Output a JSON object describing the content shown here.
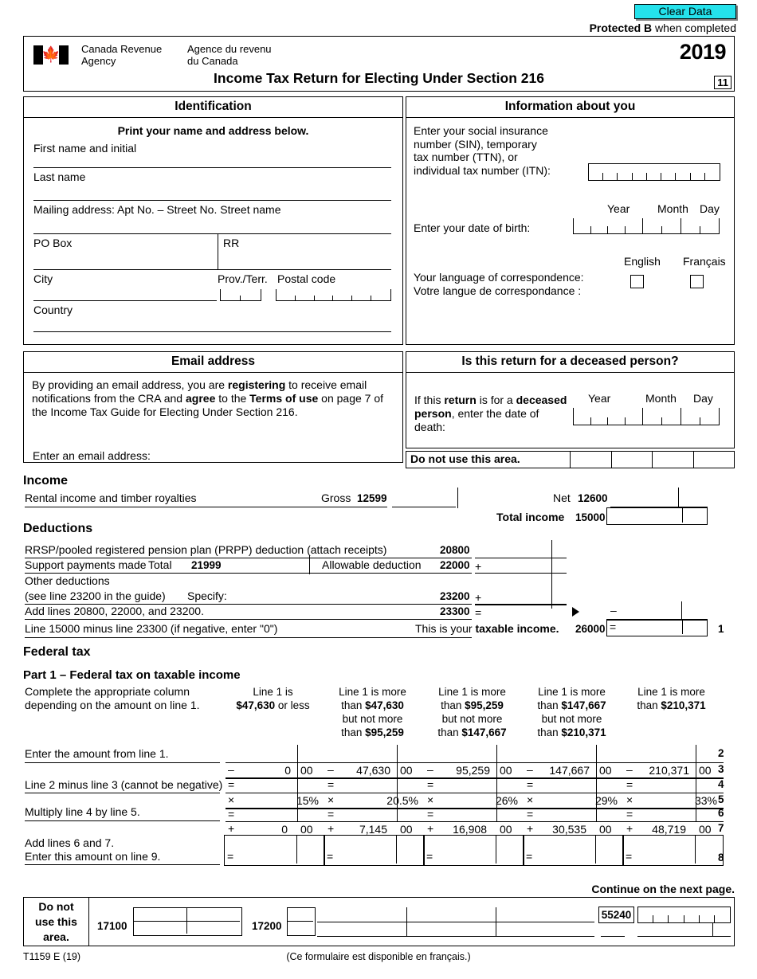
{
  "toolbar": {
    "clear_data_label": "Clear Data",
    "clear_data_color": "#24e2ec",
    "protected_bold": "Protected B",
    "protected_rest": " when completed"
  },
  "header": {
    "agency_en_line1": "Canada Revenue",
    "agency_en_line2": "Agency",
    "agency_fr_line1": "Agence du revenu",
    "agency_fr_line2": "du Canada",
    "tax_year": "2019",
    "title": "Income Tax Return for Electing Under Section 216",
    "page_number": "11"
  },
  "identification": {
    "heading": "Identification",
    "subtitle": "Print your name and address below.",
    "first_name_label": "First name and initial",
    "last_name_label": "Last name",
    "mailing_label": "Mailing address: Apt No. – Street No. Street name",
    "po_box_label": "PO Box",
    "rr_label": "RR",
    "city_label": "City",
    "prov_label": "Prov./Terr.",
    "postal_label": "Postal code",
    "country_label": "Country",
    "prov_cells": 2,
    "postal_cells": 6
  },
  "info_about_you": {
    "heading": "Information about you",
    "sin_line1": "Enter your social insurance",
    "sin_line2": "number (SIN), temporary",
    "sin_line3": "tax number (TTN), or",
    "sin_line4": "individual tax number (ITN):",
    "sin_cells": 9,
    "dob_label": "Enter your date of birth:",
    "year_label": "Year",
    "month_label": "Month",
    "day_label": "Day",
    "dob_year_cells": 4,
    "dob_month_cells": 2,
    "dob_day_cells": 2,
    "lang_en_label": "Your language of correspondence:",
    "lang_fr_label": "Votre langue de correspondance :",
    "lang_option_english": "English",
    "lang_option_francais": "Français"
  },
  "email": {
    "heading": "Email address",
    "body_1": "By providing an email address, you are ",
    "body_bold_1": "registering",
    "body_2": " to receive email notifications from the CRA and ",
    "body_bold_2": "agree",
    "body_3": " to the ",
    "body_bold_3": "Terms of use",
    "body_4": " on page 7 of the Income Tax Guide for Electing Under Section 216.",
    "enter_label": "Enter an email address:"
  },
  "deceased": {
    "heading": "Is this return for a deceased person?",
    "text_1": "If this ",
    "text_bold_1": "return",
    "text_2": " is for a ",
    "text_bold_2": "deceased person",
    "text_3": ", enter the date of death:",
    "year_label": "Year",
    "month_label": "Month",
    "day_label": "Day",
    "year_cells": 4,
    "month_cells": 2,
    "day_cells": 2,
    "do_not_use_label": "Do not use this area.",
    "do_not_use_cells": 4
  },
  "income": {
    "heading": "Income",
    "row_label": "Rental income and timber royalties",
    "gross_label": "Gross",
    "gross_code": "12599",
    "net_label": "Net",
    "net_code": "12600",
    "total_label": "Total income",
    "total_code": "15000"
  },
  "deductions": {
    "heading": "Deductions",
    "rrsp_label": "RRSP/pooled registered pension plan (PRPP) deduction (attach receipts)",
    "rrsp_code": "20800",
    "support_label": "Support payments made",
    "support_total_label": "Total",
    "support_total_code": "21999",
    "allowable_label": "Allowable deduction",
    "allowable_code": "22000",
    "allowable_op": "+",
    "other_label_1": "Other deductions",
    "other_label_2": "(see line 23200 in the guide)",
    "specify_label": "Specify:",
    "other_code": "23200",
    "other_op": "+",
    "add_label": "Add lines 20800, 22000, and 23200.",
    "add_code": "23300",
    "add_op": "=",
    "carry_op": "–",
    "taxable_label": "Line 15000 minus line 23300 (if negative, enter \"0\")",
    "taxable_this_is": "This is your ",
    "taxable_bold": "taxable income.",
    "taxable_code": "26000",
    "taxable_op": "=",
    "taxable_lineno": "1"
  },
  "federal_tax": {
    "heading": "Federal tax",
    "part1_heading": "Part 1 – Federal tax on taxable income",
    "instruction_line1": "Complete the appropriate column",
    "instruction_line2": "depending on the amount on line 1.",
    "columns": [
      {
        "head_lines": [
          "Line 1 is",
          "$47,630 or less"
        ],
        "head_bold": [
          "",
          "$47,630"
        ],
        "subtract": "0",
        "cents": "00",
        "rate": "15%",
        "add_amount": "0",
        "add_cents": "00"
      },
      {
        "head_lines": [
          "Line 1 is more",
          "than $47,630",
          "but not more",
          "than $95,259"
        ],
        "head_bold": [
          "",
          "$47,630",
          "",
          "$95,259"
        ],
        "subtract": "47,630",
        "cents": "00",
        "rate": "20.5%",
        "add_amount": "7,145",
        "add_cents": "00"
      },
      {
        "head_lines": [
          "Line 1 is more",
          "than $95,259",
          "but not more",
          "than $147,667"
        ],
        "head_bold": [
          "",
          "$95,259",
          "",
          "$147,667"
        ],
        "subtract": "95,259",
        "cents": "00",
        "rate": "26%",
        "add_amount": "16,908",
        "add_cents": "00"
      },
      {
        "head_lines": [
          "Line 1 is more",
          "than $147,667",
          "but not more",
          "than $210,371"
        ],
        "head_bold": [
          "",
          "$147,667",
          "",
          "$210,371"
        ],
        "subtract": "147,667",
        "cents": "00",
        "rate": "29%",
        "add_amount": "30,535",
        "add_cents": "00"
      },
      {
        "head_lines": [
          "Line 1 is more",
          "than $210,371"
        ],
        "head_bold": [
          "",
          "$210,371"
        ],
        "subtract": "210,371",
        "cents": "00",
        "rate": "33%",
        "add_amount": "48,719",
        "add_cents": "00"
      }
    ],
    "rows": {
      "line2_label": "Enter the amount from line 1.",
      "line2_no": "2",
      "line3_op": "–",
      "line3_no": "3",
      "line4_label": "Line 2 minus line 3 (cannot be negative)",
      "line4_op": "=",
      "line4_no": "4",
      "line5_op": "×",
      "line5_no": "5",
      "line6_label": "Multiply line 4 by line 5.",
      "line6_op": "=",
      "line6_no": "6",
      "line7_op": "+",
      "line7_no": "7",
      "line8_label_1": "Add lines 6 and 7.",
      "line8_label_2": "Enter this amount on line 9.",
      "line8_op": "=",
      "line8_no": "8"
    }
  },
  "footer": {
    "continue_label": "Continue on the next page.",
    "do_not_use_line1": "Do not",
    "do_not_use_line2": "use this",
    "do_not_use_line3": "area.",
    "code_17100": "17100",
    "code_17200": "17200",
    "code_55240": "55240",
    "code_55240_cells": 6,
    "form_id": "T1159 E (19)",
    "french_note": "(Ce formulaire est disponible en français.)"
  }
}
